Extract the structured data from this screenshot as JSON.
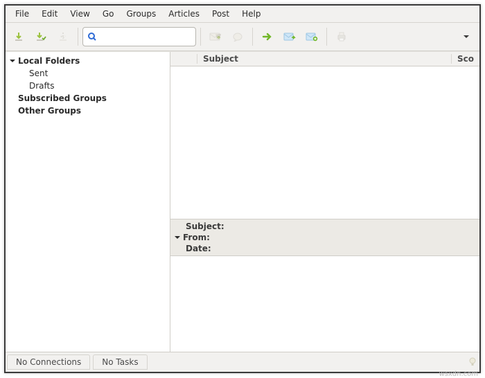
{
  "menubar": {
    "items": [
      "File",
      "Edit",
      "View",
      "Go",
      "Groups",
      "Articles",
      "Post",
      "Help"
    ]
  },
  "toolbar": {
    "search_placeholder": ""
  },
  "sidebar": {
    "local_folders": "Local Folders",
    "sent": "Sent",
    "drafts": "Drafts",
    "subscribed_groups": "Subscribed Groups",
    "other_groups": "Other Groups"
  },
  "columns": {
    "subject": "Subject",
    "score": "Sco"
  },
  "preview": {
    "subject_label": "Subject:",
    "from_label": "From:",
    "date_label": "Date:"
  },
  "status": {
    "connections": "No Connections",
    "tasks": "No Tasks"
  },
  "watermark": "wsxdn.com"
}
